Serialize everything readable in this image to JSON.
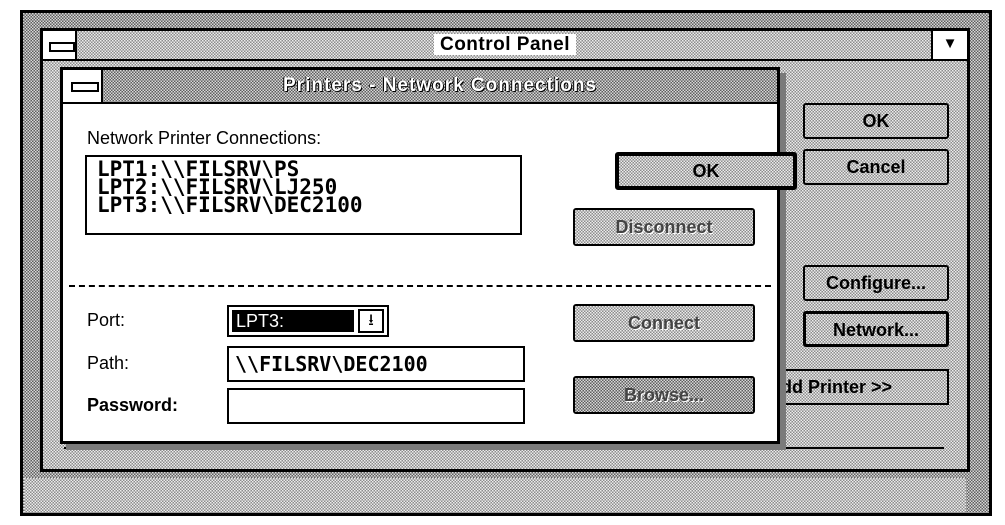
{
  "control_panel": {
    "title": "Control Panel",
    "buttons": {
      "ok": "OK",
      "cancel": "Cancel",
      "configure": "Configure...",
      "network": "Network...",
      "add_printer": "dd Printer >>"
    },
    "accelerators": {
      "configure": "C",
      "network": "N"
    }
  },
  "dialog": {
    "title": "Printers - Network Connections",
    "connections_label": "Network Printer Connections:",
    "connections": [
      "LPT1:\\\\FILSRV\\PS",
      "LPT2:\\\\FILSRV\\LJ250",
      "LPT3:\\\\FILSRV\\DEC2100"
    ],
    "buttons": {
      "ok": "OK",
      "disconnect": "Disconnect",
      "connect": "Connect",
      "browse": "Browse..."
    },
    "port_label": "Port:",
    "port_value": "LPT3:",
    "path_label": "Path:",
    "path_value": "\\\\FILSRV\\DEC2100",
    "password_label": "Password:",
    "password_value": ""
  },
  "icons": {
    "system_menu": "system-menu-icon",
    "scroll_down": "down-arrow-icon",
    "dropdown": "dropdown-arrow-icon"
  }
}
